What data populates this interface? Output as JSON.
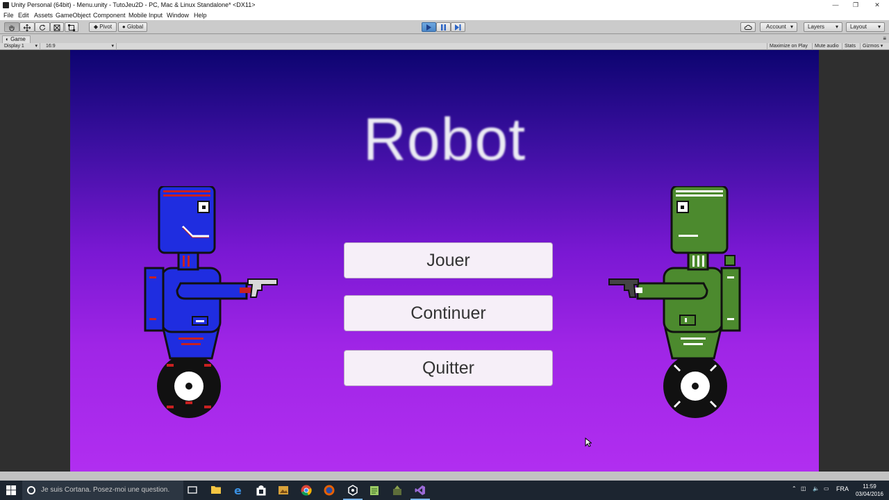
{
  "window": {
    "title": "Unity Personal (64bit) - Menu.unity - TutoJeu2D - PC, Mac & Linux Standalone* <DX11>"
  },
  "menu": [
    "File",
    "Edit",
    "Assets",
    "GameObject",
    "Component",
    "Mobile Input",
    "Window",
    "Help"
  ],
  "toolbar": {
    "pivot_label": "Pivot",
    "global_label": "Global",
    "account_label": "Account",
    "layers_label": "Layers",
    "layout_label": "Layout"
  },
  "game_view": {
    "tab_label": "Game",
    "display_label": "Display 1",
    "aspect_label": "16:9",
    "maximize_label": "Maximize on Play",
    "mute_label": "Mute audio",
    "stats_label": "Stats",
    "gizmos_label": "Gizmos"
  },
  "game": {
    "title": "Robot",
    "buttons": [
      "Jouer",
      "Continuer",
      "Quitter"
    ]
  },
  "taskbar": {
    "search_placeholder": "Je suis Cortana. Posez-moi une question.",
    "language": "FRA",
    "time": "11:59",
    "date": "03/04/2016"
  },
  "colors": {
    "game_bg_top": "#0c0470",
    "game_bg_bottom": "#b12ef0",
    "robot_blue": "#1f2de0",
    "robot_green": "#4c8a2e",
    "button_bg": "#f6eff8"
  }
}
